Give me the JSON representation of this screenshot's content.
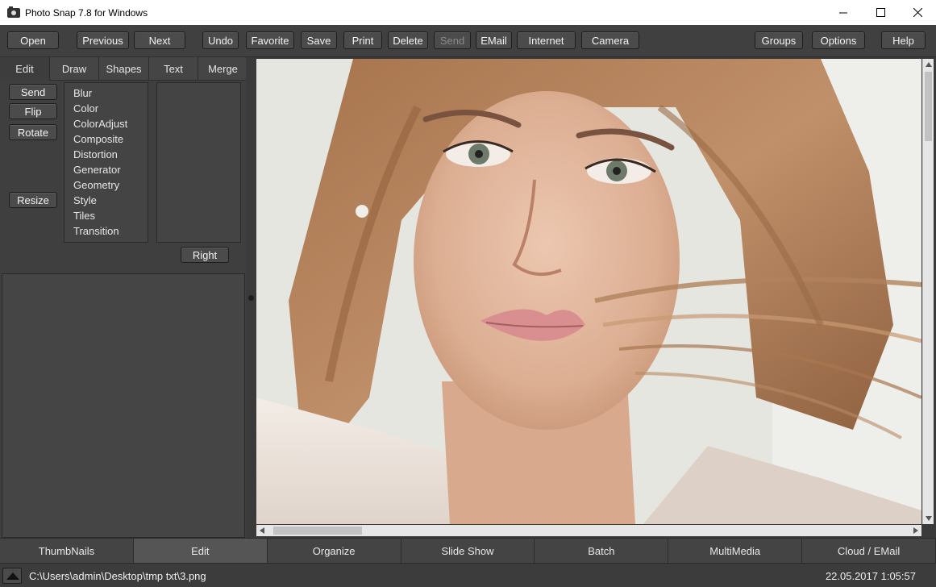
{
  "window": {
    "title": "Photo Snap 7.8 for Windows",
    "icon": "camera-icon"
  },
  "toolbar": {
    "buttons": [
      {
        "label": "Open",
        "enabled": true
      },
      {
        "label": "Previous",
        "enabled": true
      },
      {
        "label": "Next",
        "enabled": true
      },
      {
        "label": "Undo",
        "enabled": true
      },
      {
        "label": "Favorite",
        "enabled": true
      },
      {
        "label": "Save",
        "enabled": true
      },
      {
        "label": "Print",
        "enabled": true
      },
      {
        "label": "Delete",
        "enabled": true
      },
      {
        "label": "Send",
        "enabled": false
      },
      {
        "label": "EMail",
        "enabled": true
      },
      {
        "label": "Internet",
        "enabled": true
      },
      {
        "label": "Camera",
        "enabled": true
      },
      {
        "label": "Groups",
        "enabled": true
      },
      {
        "label": "Options",
        "enabled": true
      },
      {
        "label": "Help",
        "enabled": true
      }
    ]
  },
  "leftpanel": {
    "tabs": [
      {
        "label": "Edit",
        "active": true
      },
      {
        "label": "Draw",
        "active": false
      },
      {
        "label": "Shapes",
        "active": false
      },
      {
        "label": "Text",
        "active": false
      },
      {
        "label": "Merge",
        "active": false
      }
    ],
    "side_buttons": [
      "Send",
      "Flip",
      "Rotate",
      "Resize"
    ],
    "filters": [
      "Blur",
      "Color",
      "ColorAdjust",
      "Composite",
      "Distortion",
      "Generator",
      "Geometry",
      "Style",
      "Tiles",
      "Transition"
    ],
    "right_button": "Right"
  },
  "bottom_tabs": [
    {
      "label": "ThumbNails",
      "active": false
    },
    {
      "label": "Edit",
      "active": true
    },
    {
      "label": "Organize",
      "active": false
    },
    {
      "label": "Slide Show",
      "active": false
    },
    {
      "label": "Batch",
      "active": false
    },
    {
      "label": "MultiMedia",
      "active": false
    },
    {
      "label": "Cloud / EMail",
      "active": false
    }
  ],
  "status": {
    "path": "C:\\Users\\admin\\Desktop\\tmp txt\\3.png",
    "datetime": "22.05.2017 1:05:57"
  },
  "colors": {
    "panel_bg": "#3f3f3f",
    "button_bg": "#4b4b4b",
    "disabled_text": "#8a8a8a"
  }
}
